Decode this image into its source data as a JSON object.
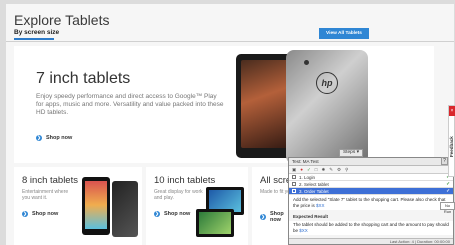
{
  "header": {
    "title": "Explore Tablets",
    "filter_tab": "By screen size",
    "view_all_label": "View All Tablets"
  },
  "hero": {
    "title": "7 inch tablets",
    "description": "Enjoy speedy performance and direct access to Google™ Play for apps, music and more. Versatility and value packed into these HD tablets.",
    "shop_label": "Shop now"
  },
  "cards": [
    {
      "title": "8 inch tablets",
      "description": "Entertainment where you want it.",
      "shop_label": "Shop now"
    },
    {
      "title": "10 inch tablets",
      "description": "Great display for work and play.",
      "shop_label": "Shop now"
    },
    {
      "title": "All screen s",
      "description": "Made to fit your l",
      "shop_label": "Shop now"
    }
  ],
  "tester": {
    "tray_label": "Steps",
    "title": "Test: MA Test",
    "steps": [
      {
        "label": "1. Login"
      },
      {
        "label": "2. Select tablet"
      },
      {
        "label": "3. Order Tablet"
      }
    ],
    "step_detail_text": "Add the selected \"Slate 7\" tablet to the shopping cart. Please also check that the price is ",
    "step_detail_link": "$XX",
    "expected_heading": "Expected Result",
    "expected_text": "The tablet should be added to the shopping cart and the amount to pay should be ",
    "expected_link": "$XX",
    "status_text": "Last Action: 4 | Duration: 00:00:00"
  },
  "side": {
    "feedback_label": "Feedback",
    "feedback_close": "×",
    "no_run_label": "No Run",
    "help_label": "?"
  },
  "colors": {
    "accent_blue": "#2f86d4",
    "feedback_red": "#d9262b",
    "active_step": "#3d6fd6"
  }
}
